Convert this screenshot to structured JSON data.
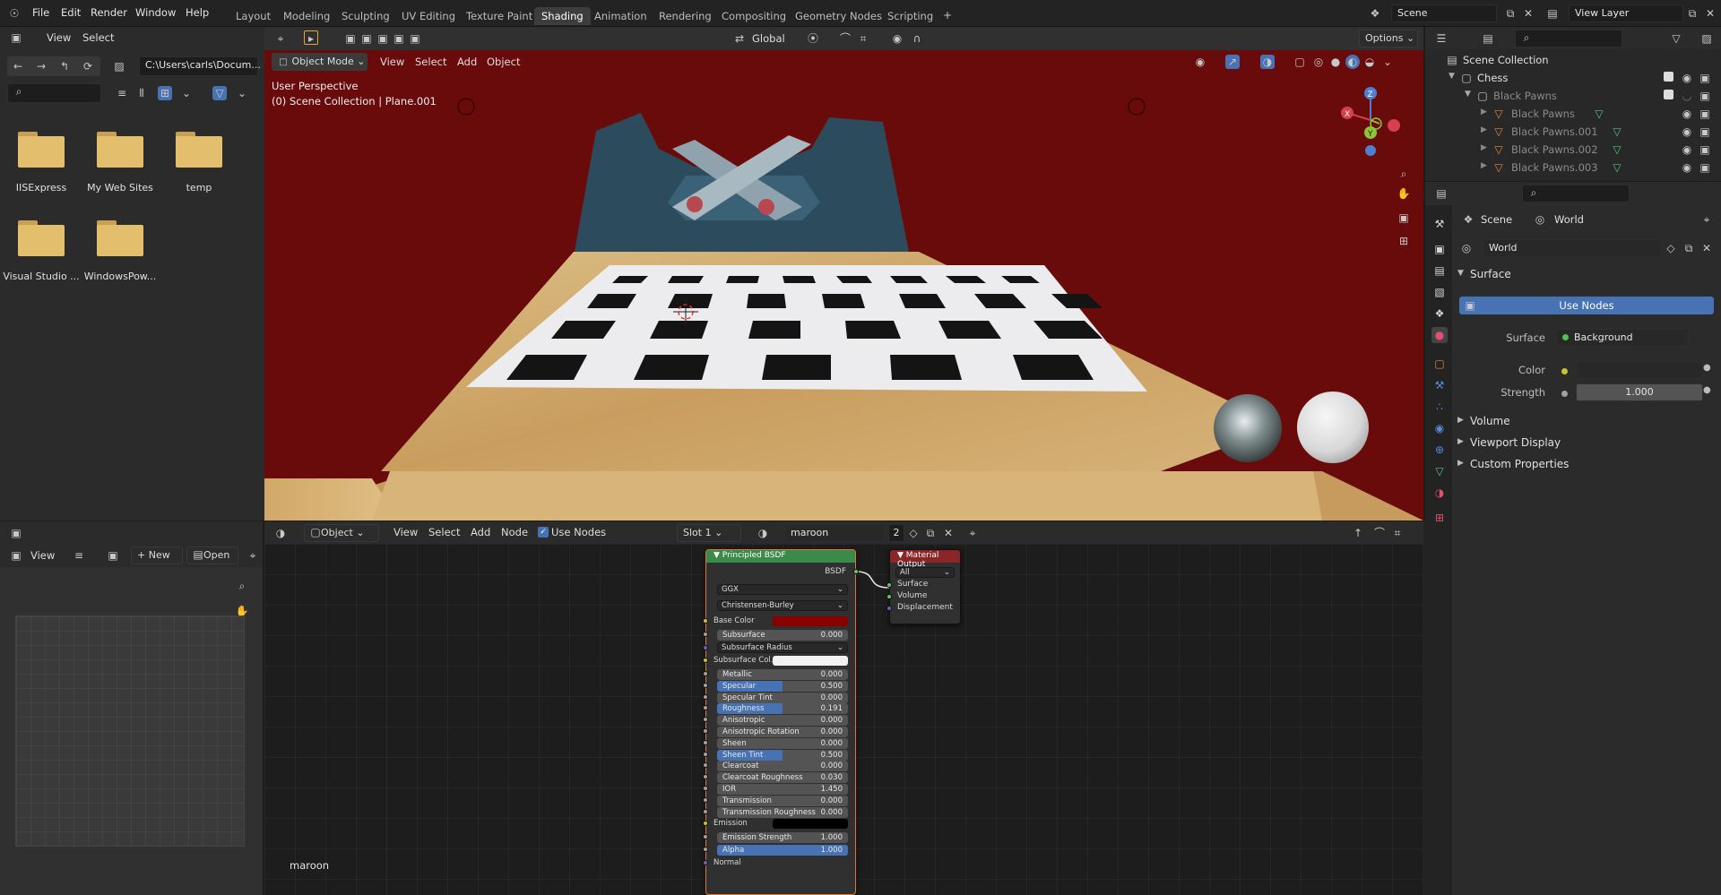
{
  "menus": [
    "File",
    "Edit",
    "Render",
    "Window",
    "Help"
  ],
  "workspaces": [
    "Layout",
    "Modeling",
    "Sculpting",
    "UV Editing",
    "Texture Paint",
    "Shading",
    "Animation",
    "Rendering",
    "Compositing",
    "Geometry Nodes",
    "Scripting"
  ],
  "active_workspace": "Shading",
  "scene_name": "Scene",
  "view_layer": "View Layer",
  "file_browser": {
    "menu": [
      "View",
      "Select"
    ],
    "path": "C:\\Users\\carls\\Docum...",
    "folders": [
      "IISExpress",
      "My Web Sites",
      "temp",
      "Visual Studio ...",
      "WindowsPow..."
    ]
  },
  "viewport": {
    "mode": "Object Mode",
    "menu": [
      "View",
      "Select",
      "Add",
      "Object"
    ],
    "orientation": "Global",
    "options_label": "Options",
    "perspective_label": "User Perspective",
    "collection_label": "(0) Scene Collection | Plane.001"
  },
  "outliner": {
    "root": "Scene Collection",
    "items": [
      "Chess",
      "Black Pawns",
      "Black Pawns",
      "Black Pawns.001",
      "Black Pawns.002",
      "Black Pawns.003"
    ]
  },
  "properties": {
    "breadcrumb_scene": "Scene",
    "breadcrumb_world": "World",
    "world_name": "World",
    "surface_panel": "Surface",
    "use_nodes_label": "Use Nodes",
    "surface_label": "Surface",
    "surface_value": "Background",
    "color_label": "Color",
    "strength_label": "Strength",
    "strength_value": "1.000",
    "collapsed_panels": [
      "Volume",
      "Viewport Display",
      "Custom Properties"
    ]
  },
  "image_editor": {
    "view_label": "View",
    "new_label": "New",
    "open_label": "Open"
  },
  "node_editor": {
    "object_label": "Object",
    "menu": [
      "View",
      "Select",
      "Add",
      "Node"
    ],
    "use_nodes_label": "Use Nodes",
    "slot_label": "Slot 1",
    "material_name": "maroon",
    "user_count": "2",
    "footer_material": "maroon",
    "bsdf_node": {
      "title": "Principled BSDF",
      "output": "BSDF",
      "distribution": "GGX",
      "subsurface_method": "Christensen-Burley",
      "base_color_label": "Base Color",
      "subsurface_radius": "Subsurface Radius",
      "subsurface_color": "Subsurface Col...",
      "emission_label": "Emission",
      "normal_label": "Normal",
      "base_color": "#8a0000",
      "sliders": [
        {
          "label": "Subsurface",
          "value": "0.000",
          "fraction": 0
        },
        {
          "label": "Metallic",
          "value": "0.000",
          "fraction": 0
        },
        {
          "label": "Specular",
          "value": "0.500",
          "fraction": 0.5
        },
        {
          "label": "Specular Tint",
          "value": "0.000",
          "fraction": 0
        },
        {
          "label": "Roughness",
          "value": "0.191",
          "fraction": 0.5
        },
        {
          "label": "Anisotropic",
          "value": "0.000",
          "fraction": 0
        },
        {
          "label": "Anisotropic Rotation",
          "value": "0.000",
          "fraction": 0
        },
        {
          "label": "Sheen",
          "value": "0.000",
          "fraction": 0
        },
        {
          "label": "Sheen Tint",
          "value": "0.500",
          "fraction": 0.5
        },
        {
          "label": "Clearcoat",
          "value": "0.000",
          "fraction": 0
        },
        {
          "label": "Clearcoat Roughness",
          "value": "0.030",
          "fraction": 0
        },
        {
          "label": "IOR",
          "value": "1.450",
          "fraction": 0
        },
        {
          "label": "Transmission",
          "value": "0.000",
          "fraction": 0
        },
        {
          "label": "Transmission Roughness",
          "value": "0.000",
          "fraction": 0
        }
      ],
      "emission_strength": {
        "label": "Emission Strength",
        "value": "1.000"
      },
      "alpha": {
        "label": "Alpha",
        "value": "1.000",
        "fraction": 1
      }
    },
    "output_node": {
      "title": "Material Output",
      "target": "All",
      "inputs": [
        "Surface",
        "Volume",
        "Displacement"
      ]
    }
  }
}
